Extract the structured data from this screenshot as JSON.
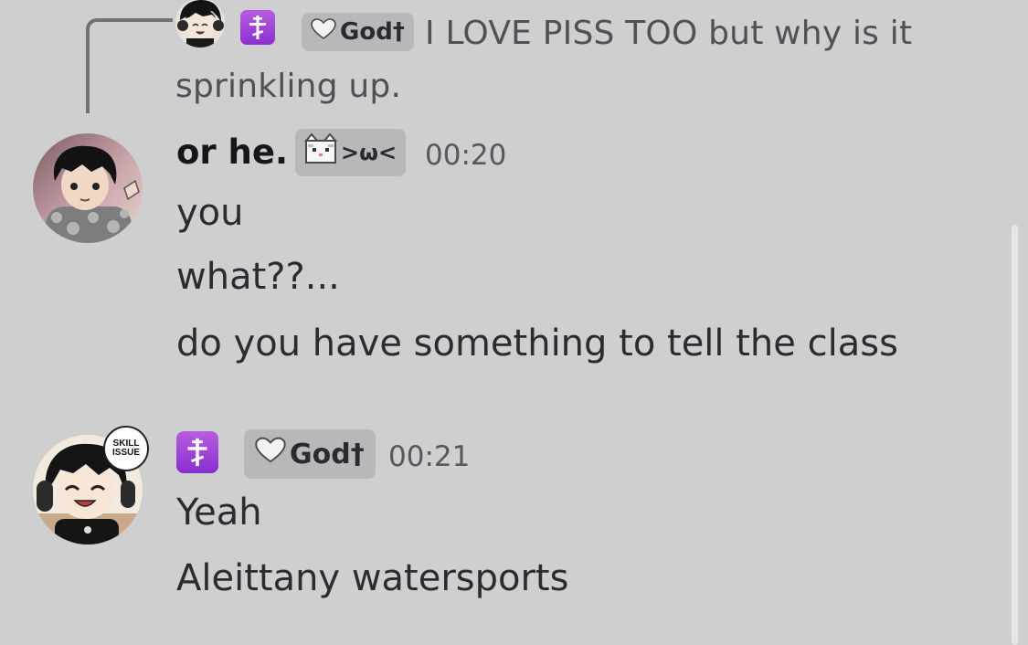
{
  "reply": {
    "tag": "God†",
    "text": "I LOVE PISS TOO but why is it sprinkling up."
  },
  "messages": [
    {
      "username": "or he.",
      "tag": ">ω<",
      "timestamp": "00:20",
      "lines": [
        "you",
        "what??...",
        "do you have something to tell the class"
      ]
    },
    {
      "tag": "God†",
      "timestamp": "00:21",
      "avatar_badge": "SKILL ISSUE",
      "lines": [
        "Yeah",
        "Aleittany watersports"
      ]
    }
  ],
  "colors": {
    "background": "#cfcfd0",
    "role_icon": "#9b3fd6",
    "tag_chip": "#b8b8ba"
  },
  "icons": {
    "role": "orthodox-cross-icon",
    "tag1": "white-heart-icon",
    "tag2": "cat-face-icon"
  }
}
